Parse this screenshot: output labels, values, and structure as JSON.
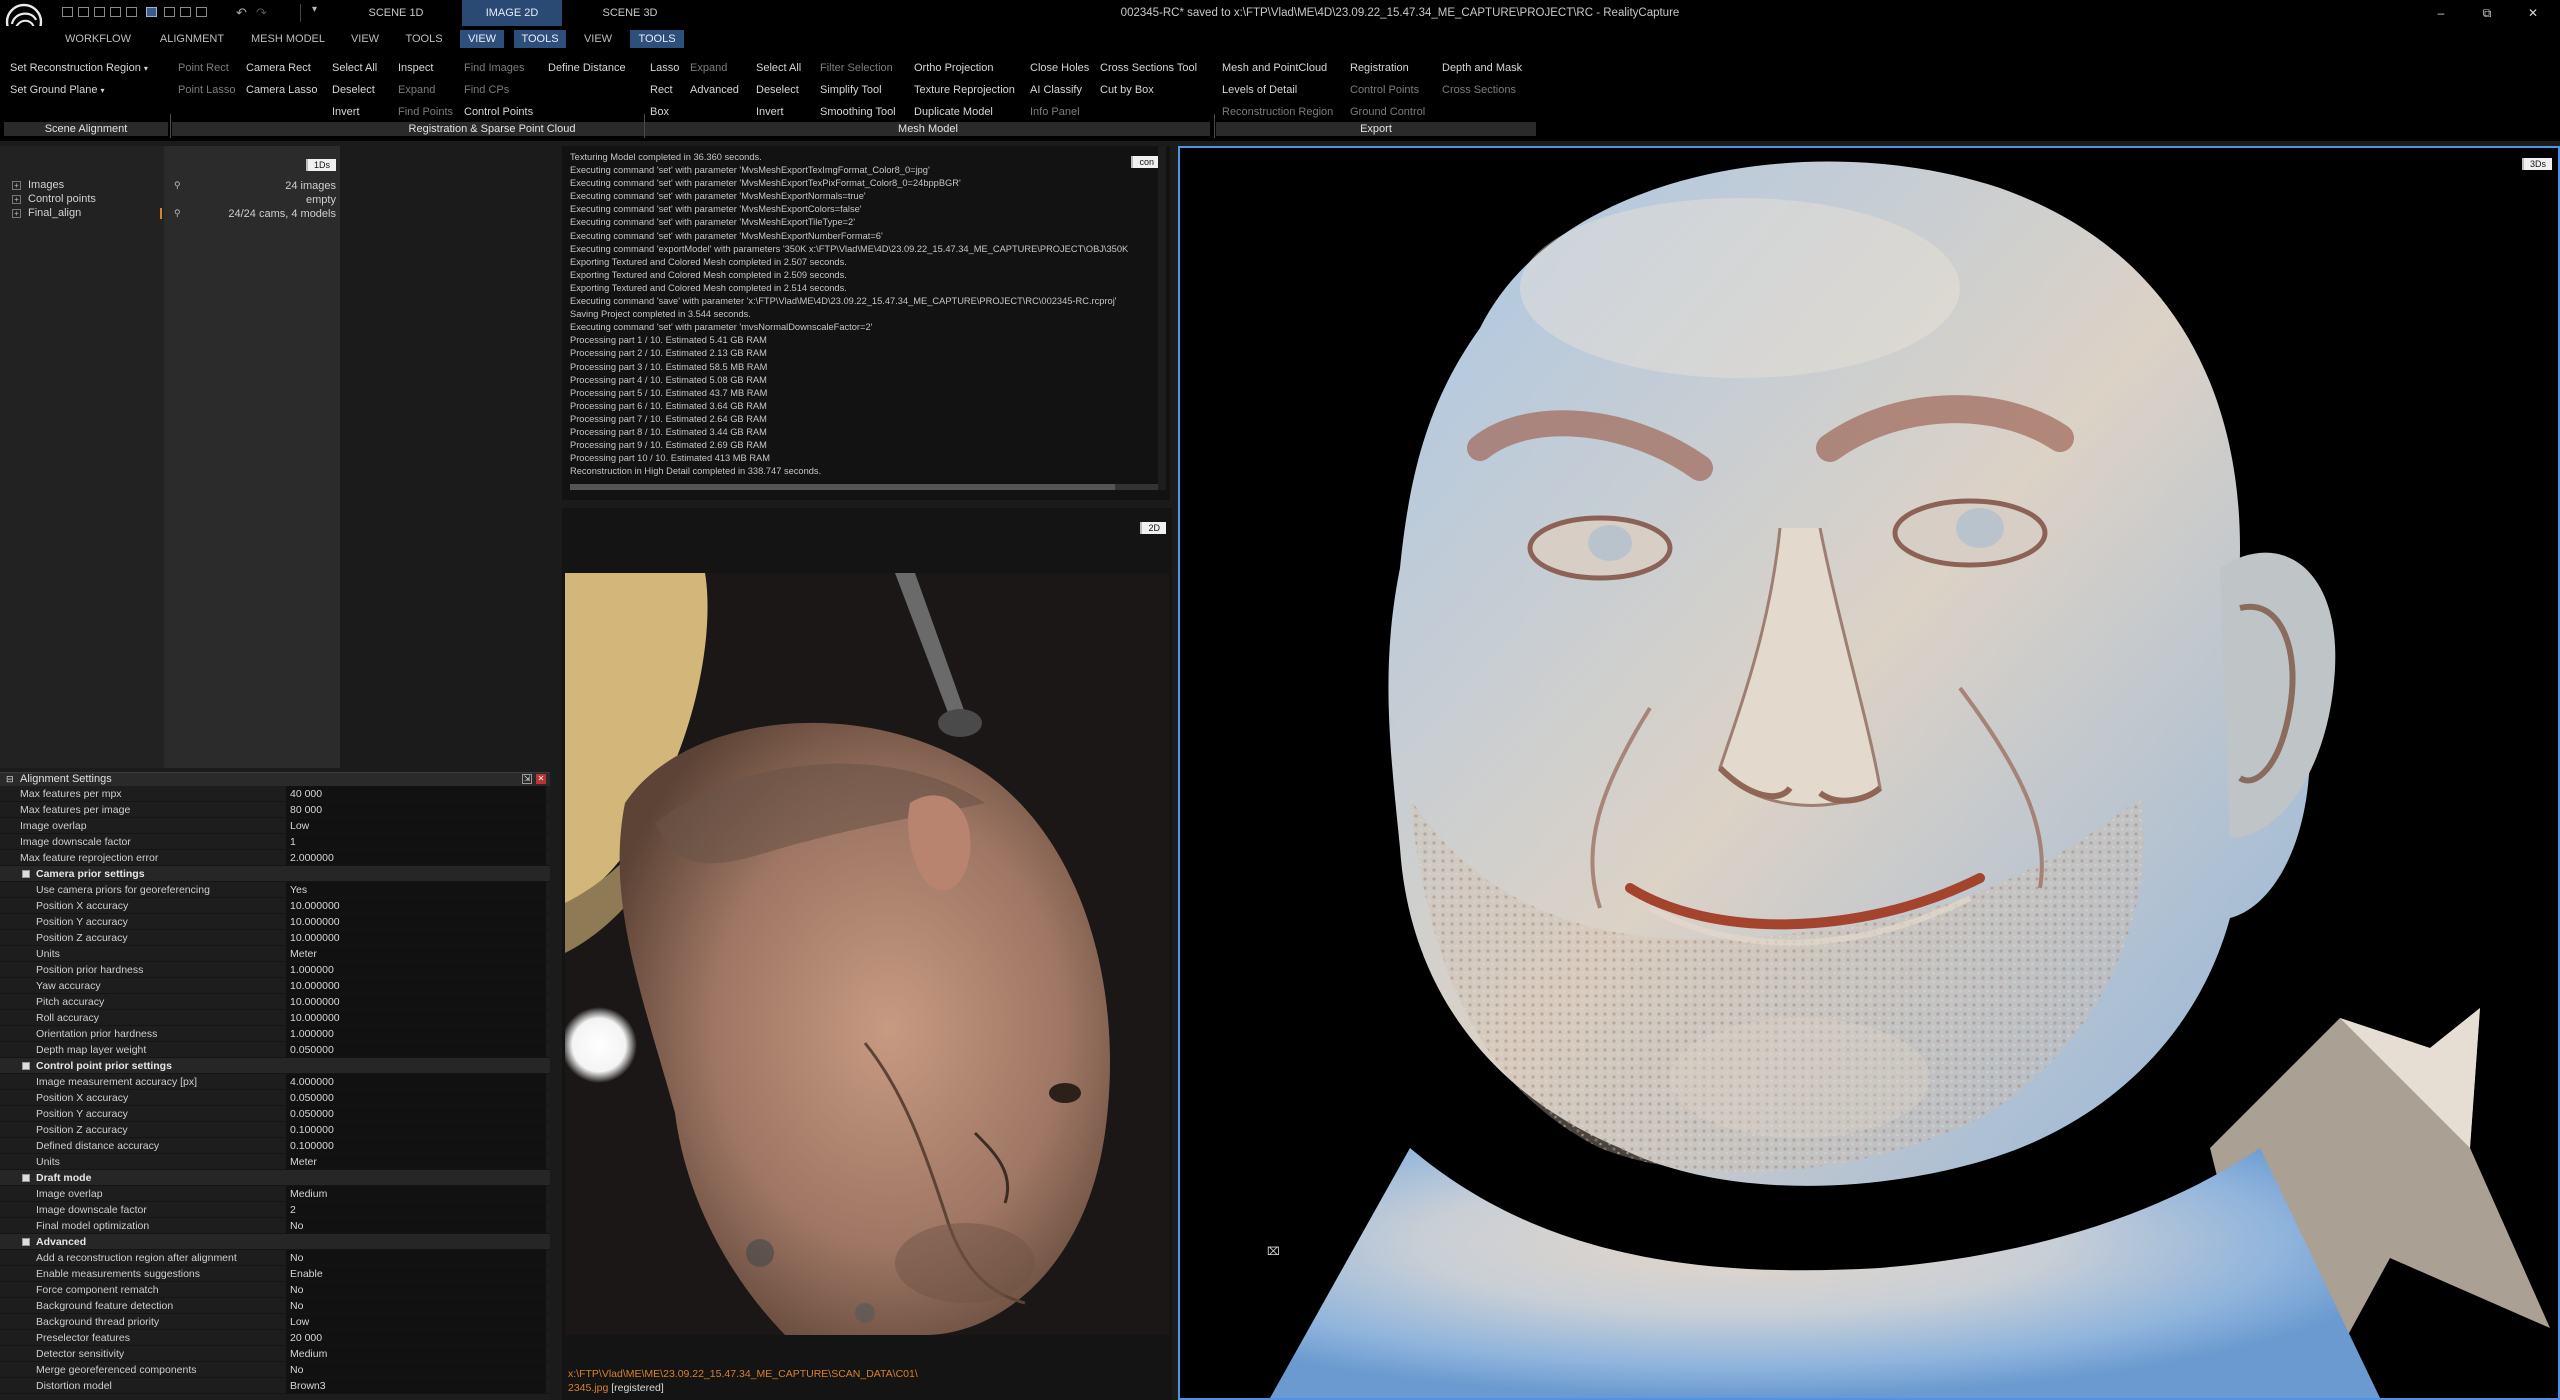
{
  "titlebar": {
    "window_title": "002345-RC* saved to x:\\FTP\\Vlad\\ME\\4D\\23.09.22_15.47.34_ME_CAPTURE\\PROJECT\\RC - RealityCapture",
    "layout_tabs": [
      "SCENE 1D",
      "IMAGE 2D",
      "SCENE 3D"
    ],
    "menu_glyph": "▾",
    "min_glyph": "–",
    "max_glyph": "⧉",
    "close_glyph": "✕"
  },
  "ribbon_tabs": [
    "WORKFLOW",
    "ALIGNMENT",
    "MESH MODEL",
    "VIEW",
    "TOOLS",
    "VIEW",
    "TOOLS",
    "VIEW",
    "TOOLS"
  ],
  "ribbon": {
    "scene_alignment": {
      "label": "Scene Alignment",
      "set_recon_region": "Set Reconstruction Region",
      "set_ground_plane": "Set Ground Plane"
    },
    "registration": {
      "label": "Registration & Sparse Point Cloud",
      "col1": [
        "Point Rect",
        "Point Lasso"
      ],
      "col2": [
        "Camera Rect",
        "Camera Lasso"
      ],
      "col3": [
        "Select All",
        "Deselect",
        "Invert"
      ],
      "col4": [
        "Inspect",
        "Expand",
        "Find Points"
      ],
      "col5": [
        "Find Images",
        "Find CPs",
        "Control Points"
      ],
      "col6": [
        "Define Distance"
      ]
    },
    "mesh_model": {
      "label": "Mesh Model",
      "col1": [
        "Lasso",
        "Rect",
        "Box"
      ],
      "col2": [
        "Expand",
        "Advanced"
      ],
      "col3": [
        "Select All",
        "Deselect",
        "Invert"
      ],
      "col4": [
        "Filter Selection",
        "Simplify Tool",
        "Smoothing Tool"
      ],
      "col5": [
        "Ortho Projection",
        "Texture Reprojection",
        "Duplicate Model"
      ],
      "col6": [
        "Close Holes",
        "AI Classify",
        "Info Panel"
      ],
      "col7": [
        "Cross Sections Tool",
        "Cut by Box"
      ]
    },
    "export": {
      "label": "Export",
      "col1": [
        "Mesh and PointCloud",
        "Levels of Detail",
        "Reconstruction Region"
      ],
      "col2": [
        "Registration",
        "Control Points",
        "Ground Control"
      ],
      "col3": [
        "Depth and Mask",
        "Cross Sections"
      ]
    }
  },
  "workspace": {
    "badge": "1Ds",
    "tree": [
      {
        "label": "Images",
        "value": "24 images"
      },
      {
        "label": "Control points",
        "value": "empty"
      },
      {
        "label": "Final_align",
        "value": "24/24 cams, 4 models"
      }
    ]
  },
  "settings": {
    "title": "Alignment Settings",
    "rows": [
      {
        "type": "top",
        "k": "Max features per mpx",
        "v": "40 000"
      },
      {
        "type": "top",
        "k": "Max features per image",
        "v": "80 000"
      },
      {
        "type": "top",
        "k": "Image overlap",
        "v": "Low"
      },
      {
        "type": "top",
        "k": "Image downscale factor",
        "v": "1"
      },
      {
        "type": "top",
        "k": "Max feature reprojection error",
        "v": "2.000000"
      },
      {
        "type": "sec",
        "k": "Camera prior settings",
        "v": ""
      },
      {
        "type": "row",
        "k": "Use camera priors for georeferencing",
        "v": "Yes"
      },
      {
        "type": "row",
        "k": "Position X accuracy",
        "v": "10.000000"
      },
      {
        "type": "row",
        "k": "Position Y accuracy",
        "v": "10.000000"
      },
      {
        "type": "row",
        "k": "Position Z accuracy",
        "v": "10.000000"
      },
      {
        "type": "row",
        "k": "Units",
        "v": "Meter"
      },
      {
        "type": "row",
        "k": "Position prior hardness",
        "v": "1.000000"
      },
      {
        "type": "row",
        "k": "Yaw accuracy",
        "v": "10.000000"
      },
      {
        "type": "row",
        "k": "Pitch accuracy",
        "v": "10.000000"
      },
      {
        "type": "row",
        "k": "Roll accuracy",
        "v": "10.000000"
      },
      {
        "type": "row",
        "k": "Orientation prior hardness",
        "v": "1.000000"
      },
      {
        "type": "row",
        "k": "Depth map layer weight",
        "v": "0.050000"
      },
      {
        "type": "sec",
        "k": "Control point prior settings",
        "v": ""
      },
      {
        "type": "row",
        "k": "Image measurement accuracy [px]",
        "v": "4.000000"
      },
      {
        "type": "row",
        "k": "Position X accuracy",
        "v": "0.050000"
      },
      {
        "type": "row",
        "k": "Position Y accuracy",
        "v": "0.050000"
      },
      {
        "type": "row",
        "k": "Position Z accuracy",
        "v": "0.100000"
      },
      {
        "type": "row",
        "k": "Defined distance accuracy",
        "v": "0.100000"
      },
      {
        "type": "row",
        "k": "Units",
        "v": "Meter"
      },
      {
        "type": "sec",
        "k": "Draft mode",
        "v": ""
      },
      {
        "type": "row",
        "k": "Image overlap",
        "v": "Medium"
      },
      {
        "type": "row",
        "k": "Image downscale factor",
        "v": "2"
      },
      {
        "type": "row",
        "k": "Final model optimization",
        "v": "No"
      },
      {
        "type": "sec",
        "k": "Advanced",
        "v": ""
      },
      {
        "type": "row",
        "k": "Add a reconstruction region after alignment",
        "v": "No"
      },
      {
        "type": "row",
        "k": "Enable measurements suggestions",
        "v": "Enable"
      },
      {
        "type": "row",
        "k": "Force component rematch",
        "v": "No"
      },
      {
        "type": "row",
        "k": "Background feature detection",
        "v": "No"
      },
      {
        "type": "row",
        "k": "Background thread priority",
        "v": "Low"
      },
      {
        "type": "row",
        "k": "Preselector features",
        "v": "20 000"
      },
      {
        "type": "row",
        "k": "Detector sensitivity",
        "v": "Medium"
      },
      {
        "type": "row",
        "k": "Merge georeferenced components",
        "v": "No"
      },
      {
        "type": "row",
        "k": "Distortion model",
        "v": "Brown3"
      }
    ]
  },
  "console": {
    "badge": "con",
    "lines": [
      "Texturing Model completed in 36.360 seconds.",
      "Executing command 'set' with parameter 'MvsMeshExportTexImgFormat_Color8_0=jpg'",
      "Executing command 'set' with parameter 'MvsMeshExportTexPixFormat_Color8_0=24bppBGR'",
      "Executing command 'set' with parameter 'MvsMeshExportNormals=true'",
      "Executing command 'set' with parameter 'MvsMeshExportColors=false'",
      "Executing command 'set' with parameter 'MvsMeshExportTileType=2'",
      "Executing command 'set' with parameter 'MvsMeshExportNumberFormat=6'",
      "Executing command 'exportModel' with parameters '350K x:\\FTP\\Vlad\\ME\\4D\\23.09.22_15.47.34_ME_CAPTURE\\PROJECT\\OBJ\\350K",
      "Exporting Textured and Colored Mesh completed in 2.507 seconds.",
      "Exporting Textured and Colored Mesh completed in 2.509 seconds.",
      "Exporting Textured and Colored Mesh completed in 2.514 seconds.",
      "Executing command 'save' with parameter 'x:\\FTP\\Vlad\\ME\\4D\\23.09.22_15.47.34_ME_CAPTURE\\PROJECT\\RC\\002345-RC.rcproj'",
      "Saving Project completed in 3.544 seconds.",
      "Executing command 'set' with parameter 'mvsNormalDownscaleFactor=2'",
      "Processing part 1 / 10. Estimated 5.41 GB RAM",
      "Processing part 2 / 10. Estimated 2.13 GB RAM",
      "Processing part 3 / 10. Estimated 58.5 MB RAM",
      "Processing part 4 / 10. Estimated 5.08 GB RAM",
      "Processing part 5 / 10. Estimated 43.7 MB RAM",
      "Processing part 6 / 10. Estimated 3.64 GB RAM",
      "Processing part 7 / 10. Estimated 2.64 GB RAM",
      "Processing part 8 / 10. Estimated 3.44 GB RAM",
      "Processing part 9 / 10. Estimated 2.69 GB RAM",
      "Processing part 10 / 10. Estimated 413 MB RAM",
      "Reconstruction in High Detail completed in 338.747 seconds."
    ]
  },
  "view2d": {
    "badge": "2D",
    "path": "x:\\FTP\\Vlad\\ME\\ME\\23.09.22_15.47.34_ME_CAPTURE\\SCAN_DATA\\C01\\",
    "file": "2345.jpg",
    "status": "[registered]"
  },
  "view3d": {
    "badge": "3Ds"
  },
  "colors": {
    "accent": "#4e93e6",
    "active_tab": "#2b4a73",
    "path_text": "#d9802f"
  }
}
